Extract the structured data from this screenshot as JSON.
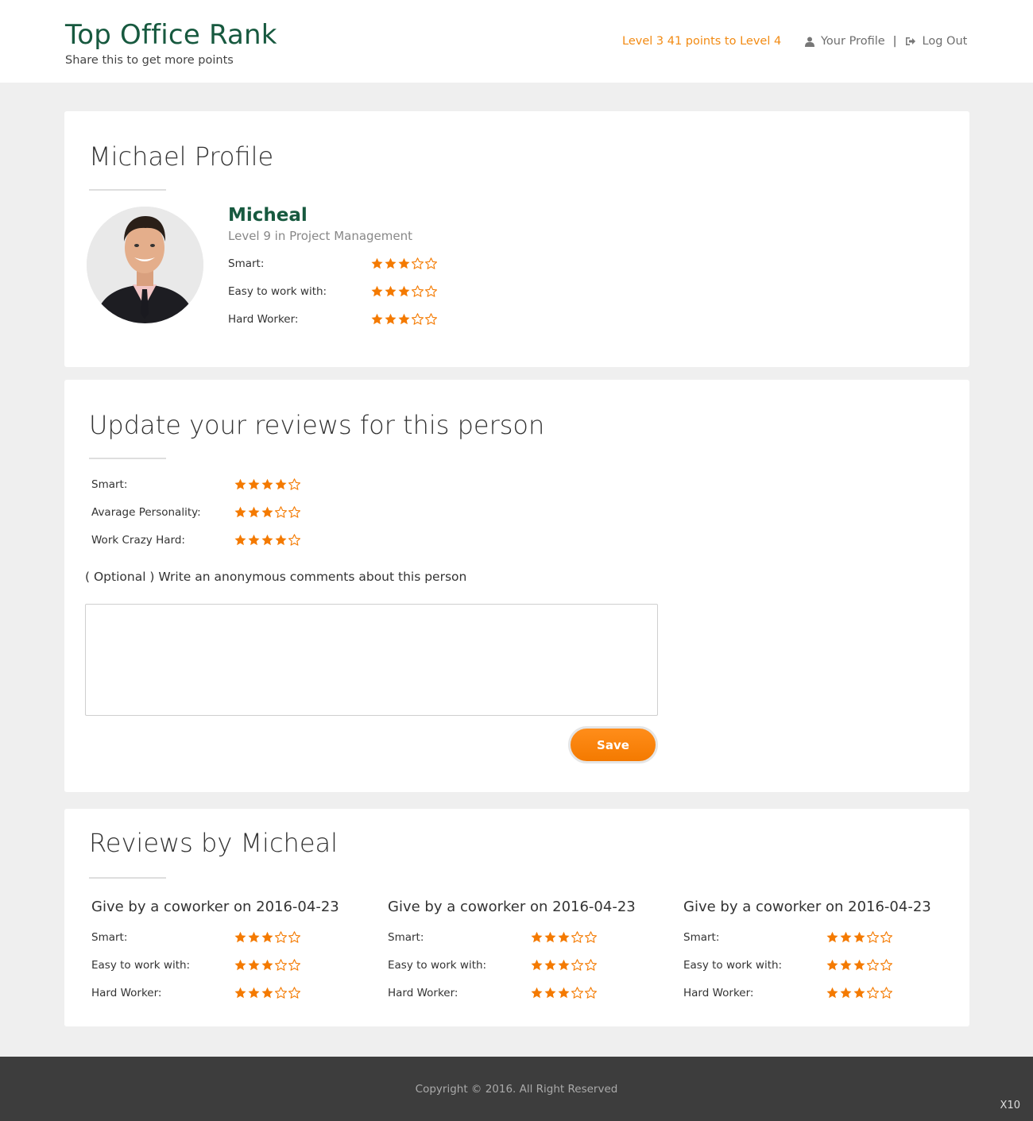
{
  "header": {
    "title": "Top Office Rank",
    "subtitle": "Share this to get more points",
    "level_status": "Level 3 41 points to Level 4",
    "profile_link": "Your Profile",
    "separator": "|",
    "logout_link": "Log Out"
  },
  "profile": {
    "heading": "Michael Profile",
    "name": "Micheal",
    "level": "Level 9 in Project Management",
    "ratings": [
      {
        "label": "Smart:",
        "value": 3,
        "max": 5
      },
      {
        "label": "Easy to work with:",
        "value": 3,
        "max": 5
      },
      {
        "label": "Hard Worker:",
        "value": 3,
        "max": 5
      }
    ]
  },
  "update": {
    "heading": "Update your reviews for this person",
    "ratings": [
      {
        "label": "Smart:",
        "value": 4,
        "max": 5
      },
      {
        "label": "Avarage Personality:",
        "value": 3,
        "max": 5
      },
      {
        "label": "Work Crazy Hard:",
        "value": 4,
        "max": 5
      }
    ],
    "optional_label": "( Optional ) Write an anonymous comments about this person",
    "comment_value": "",
    "save_label": "Save"
  },
  "reviews": {
    "heading": "Reviews by Micheal",
    "items": [
      {
        "title": "Give by a coworker on 2016-04-23",
        "ratings": [
          {
            "label": "Smart:",
            "value": 3,
            "max": 5
          },
          {
            "label": "Easy to work with:",
            "value": 3,
            "max": 5
          },
          {
            "label": "Hard Worker:",
            "value": 3,
            "max": 5
          }
        ]
      },
      {
        "title": "Give by a coworker on 2016-04-23",
        "ratings": [
          {
            "label": "Smart:",
            "value": 3,
            "max": 5
          },
          {
            "label": "Easy to work with:",
            "value": 3,
            "max": 5
          },
          {
            "label": "Hard Worker:",
            "value": 3,
            "max": 5
          }
        ]
      },
      {
        "title": "Give by a coworker on 2016-04-23",
        "ratings": [
          {
            "label": "Smart:",
            "value": 3,
            "max": 5
          },
          {
            "label": "Easy to work with:",
            "value": 3,
            "max": 5
          },
          {
            "label": "Hard Worker:",
            "value": 3,
            "max": 5
          }
        ]
      }
    ]
  },
  "footer": {
    "copyright": "Copyright © 2016. All Right Reserved",
    "corner_text": "X10"
  },
  "colors": {
    "brand": "#17593f",
    "accent": "#f28a12",
    "star": "#f47a00"
  }
}
